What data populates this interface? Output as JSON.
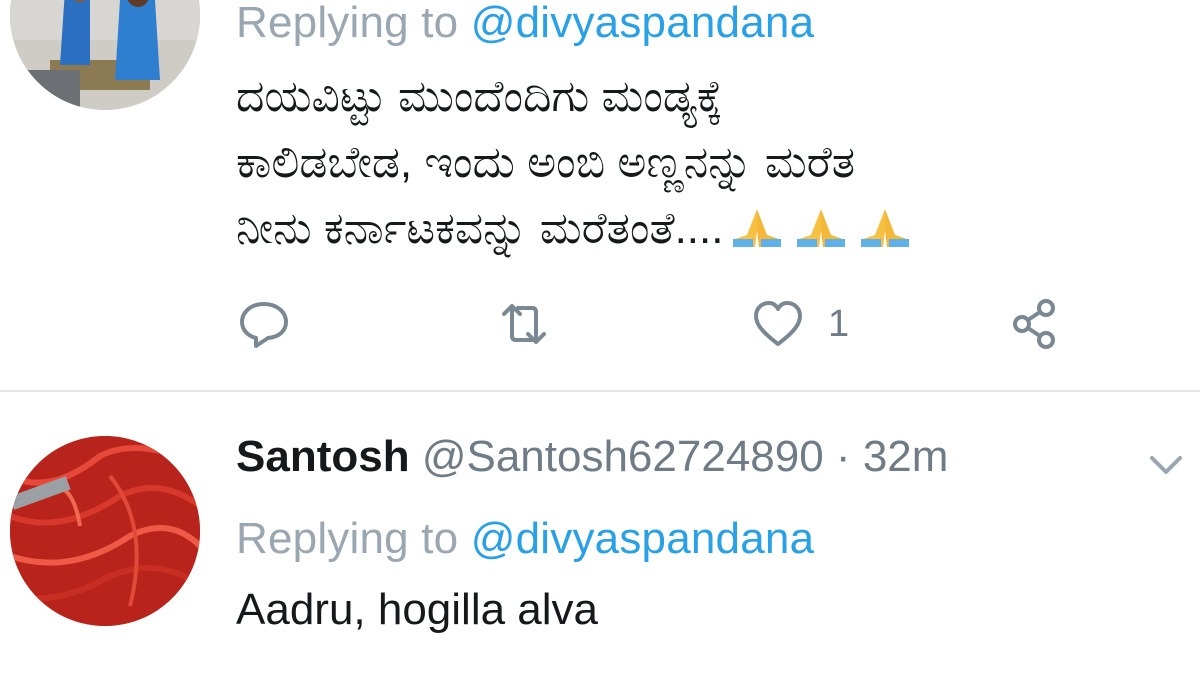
{
  "tweet1": {
    "replying_prefix": "Replying to ",
    "replying_handle": "@divyaspandana",
    "lines": [
      "ದಯವಿಟ್ಟು ಮುಂದೆಂದಿಗು ಮಂಡ್ಯಕ್ಕೆ",
      "ಕಾಲಿಡಬೇಡ, ಇಂದು ಅಂಬಿ ಅಣ್ಣನನ್ನು ಮರೆತ",
      "ನೀನು ಕರ್ನಾಟಕವನ್ನು ಮರೆತಂತೆ...."
    ],
    "trailing_emoji": [
      "folded-hands-emoji",
      "folded-hands-emoji",
      "folded-hands-emoji"
    ],
    "actions": {
      "reply_icon": "reply-icon",
      "retweet_icon": "retweet-icon",
      "like_icon": "heart-icon",
      "like_count": "1",
      "share_icon": "share-icon"
    }
  },
  "tweet2": {
    "name": "Santosh",
    "handle": "@Santosh62724890",
    "separator": " · ",
    "time": "32m",
    "replying_prefix": "Replying to ",
    "replying_handle": "@divyaspandana",
    "text": "Aadru, hogilla alva",
    "menu_icon": "chevron-down-icon"
  },
  "colors": {
    "link": "#2aa0e6",
    "muted": "#9aa6b1",
    "icon": "#7a8894",
    "text": "#16191c"
  }
}
